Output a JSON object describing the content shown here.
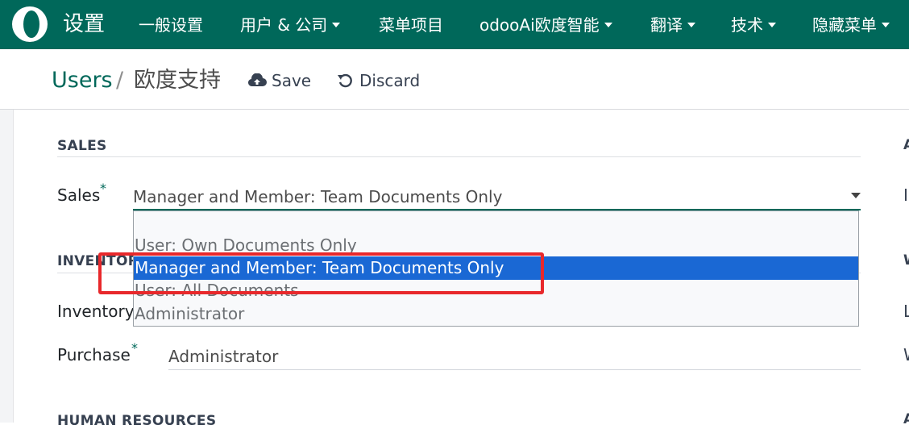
{
  "navbar": {
    "app_title": "设置",
    "items": [
      {
        "label": "一般设置",
        "dropdown": false
      },
      {
        "label": "用户 & 公司",
        "dropdown": true
      },
      {
        "label": "菜单项目",
        "dropdown": false
      },
      {
        "label": "odooAi欧度智能",
        "dropdown": true
      },
      {
        "label": "翻译",
        "dropdown": true
      },
      {
        "label": "技术",
        "dropdown": true
      },
      {
        "label": "隐藏菜单",
        "dropdown": true
      }
    ],
    "color": "#00685a"
  },
  "breadcrumb": {
    "parent": "Users",
    "separator": "/",
    "current": "欧度支持"
  },
  "actions": {
    "save": "Save",
    "discard": "Discard"
  },
  "sections": {
    "sales_title": "SALES",
    "inventory_title": "INVENTORY",
    "hr_title": "HUMAN RESOURCES"
  },
  "fields": {
    "sales_label": "Sales",
    "sales_value": "Manager and Member: Team Documents Only",
    "inventory_label": "Inventory",
    "purchase_label": "Purchase",
    "purchase_value": "Administrator",
    "required_mark": "*"
  },
  "dropdown": {
    "options": [
      "",
      "User: Own Documents Only",
      "Manager and Member: Team Documents Only",
      "User: All Documents",
      "Administrator"
    ],
    "selected_index": 2
  },
  "right_column_letters": [
    "A",
    "I",
    "W",
    "L",
    "W",
    "A"
  ],
  "colors": {
    "accent": "#00685a",
    "selection": "#1a68d4",
    "annotation": "#e8282b"
  }
}
